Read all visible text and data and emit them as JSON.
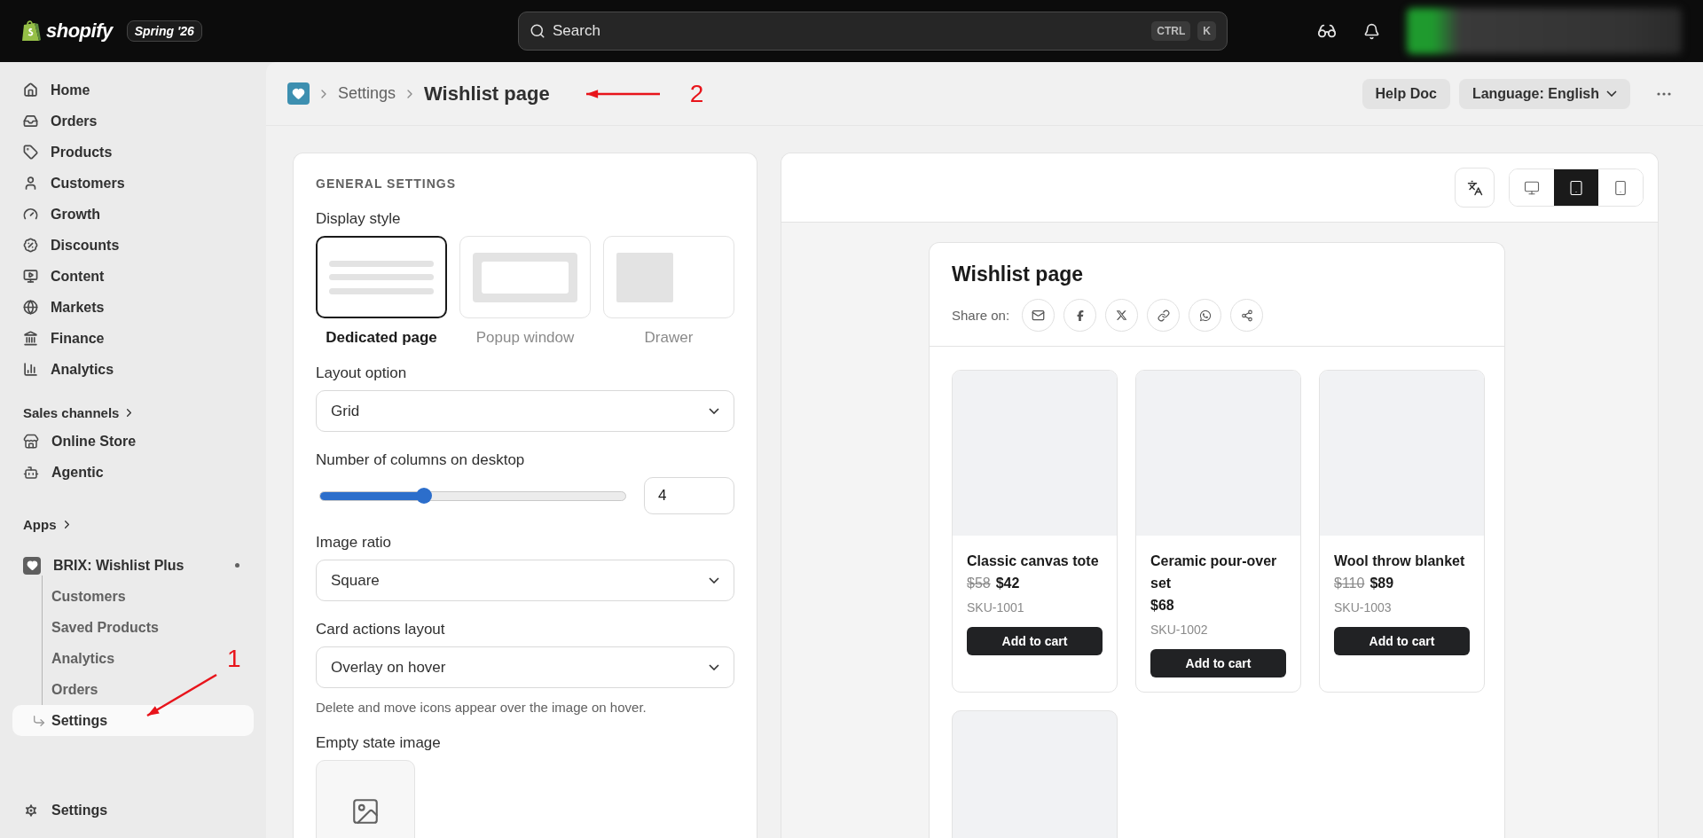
{
  "topbar": {
    "brand": "shopify",
    "edition": "Spring '26",
    "search": {
      "placeholder": "Search",
      "keys": [
        "CTRL",
        "K"
      ]
    }
  },
  "sidebar": {
    "items": [
      {
        "label": "Home"
      },
      {
        "label": "Orders"
      },
      {
        "label": "Products"
      },
      {
        "label": "Customers"
      },
      {
        "label": "Growth"
      },
      {
        "label": "Discounts"
      },
      {
        "label": "Content"
      },
      {
        "label": "Markets"
      },
      {
        "label": "Finance"
      },
      {
        "label": "Analytics"
      }
    ],
    "sales_channels": {
      "label": "Sales channels",
      "items": [
        {
          "label": "Online Store"
        },
        {
          "label": "Agentic"
        }
      ]
    },
    "apps": {
      "label": "Apps",
      "app": {
        "label": "BRIX: Wishlist Plus",
        "items": [
          {
            "label": "Customers",
            "selected": false
          },
          {
            "label": "Saved Products",
            "selected": false
          },
          {
            "label": "Analytics",
            "selected": false
          },
          {
            "label": "Orders",
            "selected": false
          },
          {
            "label": "Settings",
            "selected": true,
            "annotation": "1"
          }
        ]
      }
    },
    "footer": {
      "label": "Settings"
    }
  },
  "header": {
    "breadcrumb": [
      {
        "label": "Settings"
      }
    ],
    "title": "Wishlist page",
    "annotation": "2",
    "actions": [
      {
        "label": "Help Doc",
        "kind": "button"
      },
      {
        "label": "Language: English",
        "kind": "dropdown"
      }
    ]
  },
  "settings": {
    "heading": "GENERAL SETTINGS",
    "display_style": {
      "label": "Display style",
      "options": [
        {
          "label": "Dedicated page",
          "kind": "page",
          "selected": true
        },
        {
          "label": "Popup window",
          "kind": "popup",
          "selected": false
        },
        {
          "label": "Drawer",
          "kind": "drawer",
          "selected": false
        }
      ]
    },
    "fields": [
      {
        "kind": "select",
        "label": "Layout option",
        "value": "Grid"
      },
      {
        "kind": "slider",
        "label": "Number of columns on desktop",
        "level": 0.34,
        "value": "4"
      },
      {
        "kind": "select",
        "label": "Image ratio",
        "value": "Square"
      },
      {
        "kind": "select",
        "label": "Card actions layout",
        "value": "Overlay on hover",
        "help": "Delete and move icons appear over the image on hover."
      },
      {
        "kind": "image",
        "label": "Empty state image"
      }
    ]
  },
  "preview": {
    "devices": [
      {
        "kind": "desktop",
        "selected": false
      },
      {
        "kind": "tablet",
        "selected": true
      },
      {
        "kind": "mobile",
        "selected": false
      }
    ],
    "title": "Wishlist page",
    "share_label": "Share on:",
    "share_targets": [
      {
        "kind": "email"
      },
      {
        "kind": "facebook"
      },
      {
        "kind": "x"
      },
      {
        "kind": "link"
      },
      {
        "kind": "whatsapp"
      },
      {
        "kind": "share"
      }
    ],
    "products": [
      {
        "kind": "full",
        "name": "Classic canvas tote",
        "compare_price": "$58",
        "price": "$42",
        "sku": "SKU-1001",
        "button": "Add to cart"
      },
      {
        "kind": "full",
        "name": "Ceramic pour-over set",
        "price": "$68",
        "sku": "SKU-1002",
        "button": "Add to cart"
      },
      {
        "kind": "full",
        "name": "Wool throw blanket",
        "compare_price": "$110",
        "price": "$89",
        "sku": "SKU-1003",
        "button": "Add to cart"
      },
      {
        "kind": "image-only"
      }
    ]
  }
}
